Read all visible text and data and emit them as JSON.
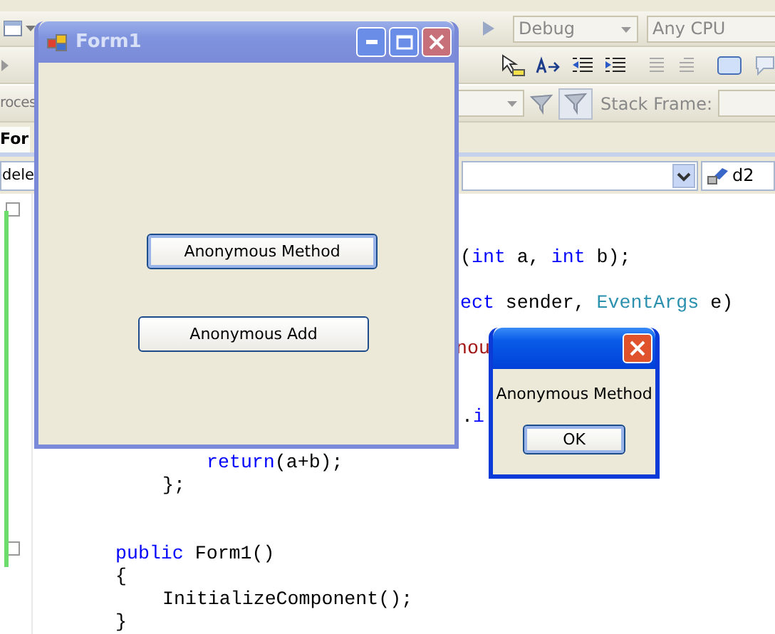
{
  "ide": {
    "configuration": "Debug",
    "platform": "Any CPU",
    "process_label": "roces",
    "stack_frame_label": "Stack Frame:",
    "tabs": [
      {
        "label": "For",
        "selected": true
      }
    ],
    "type_dropdown": "dele",
    "member_dropdown": "d2",
    "code_lines": [
      {
        "segments": [
          {
            "text": "(",
            "kind": "plain"
          },
          {
            "text": "int",
            "kind": "keyword"
          },
          {
            "text": " a, ",
            "kind": "plain"
          },
          {
            "text": "int",
            "kind": "keyword"
          },
          {
            "text": " b);",
            "kind": "plain"
          }
        ]
      },
      {
        "segments": [
          {
            "text": "ect",
            "kind": "keyword"
          },
          {
            "text": " sender, ",
            "kind": "plain"
          },
          {
            "text": "EventArgs",
            "kind": "type"
          },
          {
            "text": " e)",
            "kind": "plain"
          }
        ]
      },
      {
        "segments": [
          {
            "text": "nou",
            "kind": "string"
          }
        ]
      },
      {
        "segments": [
          {
            "text": ".",
            "kind": "plain"
          },
          {
            "text": "i",
            "kind": "keyword"
          }
        ]
      },
      {
        "segments": [
          {
            "text": "return",
            "kind": "keyword"
          },
          {
            "text": "(a+b);",
            "kind": "plain"
          }
        ]
      },
      {
        "segments": [
          {
            "text": "};",
            "kind": "plain"
          }
        ]
      },
      {
        "segments": [
          {
            "text": "public",
            "kind": "keyword"
          },
          {
            "text": " Form1()",
            "kind": "plain"
          }
        ]
      },
      {
        "segments": [
          {
            "text": "{",
            "kind": "plain"
          }
        ]
      },
      {
        "segments": [
          {
            "text": "InitializeComponent();",
            "kind": "plain"
          }
        ]
      },
      {
        "segments": [
          {
            "text": "}",
            "kind": "plain"
          }
        ]
      }
    ]
  },
  "form_window": {
    "title": "Form1",
    "active": false,
    "buttons": [
      {
        "label": "Anonymous Method",
        "focused": true
      },
      {
        "label": "Anonymous Add",
        "focused": false
      }
    ]
  },
  "message_box": {
    "active": true,
    "message": "Anonymous Method",
    "button": "OK"
  }
}
